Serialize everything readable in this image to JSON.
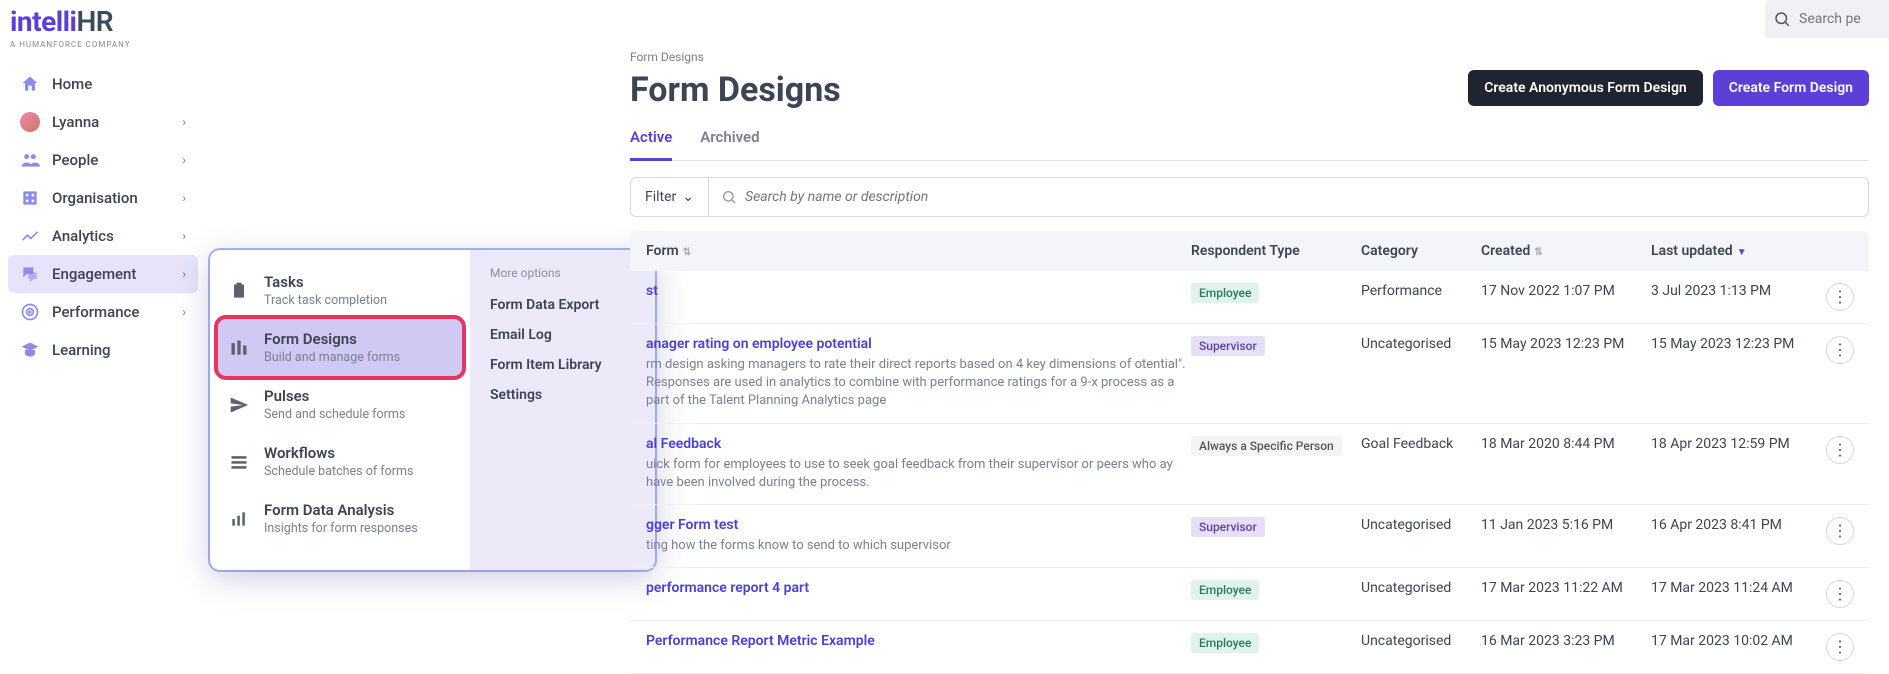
{
  "logo": {
    "brand": "intelli",
    "suffix": "HR",
    "tagline": "A HUMANFORCE COMPANY"
  },
  "search_placeholder": "Search pe",
  "sidebar": [
    {
      "label": "Home",
      "icon": "home",
      "expandable": false
    },
    {
      "label": "Lyanna",
      "icon": "avatar",
      "expandable": true
    },
    {
      "label": "People",
      "icon": "people",
      "expandable": true
    },
    {
      "label": "Organisation",
      "icon": "org",
      "expandable": true
    },
    {
      "label": "Analytics",
      "icon": "analytics",
      "expandable": true
    },
    {
      "label": "Engagement",
      "icon": "engagement",
      "expandable": true,
      "active": true
    },
    {
      "label": "Performance",
      "icon": "performance",
      "expandable": true
    },
    {
      "label": "Learning",
      "icon": "learning",
      "expandable": false
    }
  ],
  "flyout": {
    "items": [
      {
        "title": "Tasks",
        "desc": "Track task completion",
        "icon": "clipboard"
      },
      {
        "title": "Form Designs",
        "desc": "Build and manage forms",
        "icon": "forms",
        "selected": true
      },
      {
        "title": "Pulses",
        "desc": "Send and schedule forms",
        "icon": "send"
      },
      {
        "title": "Workflows",
        "desc": "Schedule batches of forms",
        "icon": "workflow"
      },
      {
        "title": "Form Data Analysis",
        "desc": "Insights for form responses",
        "icon": "chart"
      }
    ],
    "more_label": "More options",
    "links": [
      "Form Data Export",
      "Email Log",
      "Form Item Library",
      "Settings"
    ]
  },
  "breadcrumb": "Form Designs",
  "page_title": "Form Designs",
  "buttons": {
    "anon": "Create Anonymous Form Design",
    "create": "Create Form Design"
  },
  "tabs": {
    "active": "Active",
    "archived": "Archived"
  },
  "filter": {
    "label": "Filter",
    "search_placeholder": "Search by name or description"
  },
  "columns": {
    "form": "Form",
    "respondent": "Respondent Type",
    "category": "Category",
    "created": "Created",
    "updated": "Last updated"
  },
  "rows": [
    {
      "name": "st",
      "desc": "",
      "respondent": "Employee",
      "resp_class": "employee",
      "category": "Performance",
      "created": "17 Nov 2022 1:07 PM",
      "updated": "3 Jul 2023 1:13 PM"
    },
    {
      "name": "anager rating on employee potential",
      "desc": "rm design asking managers to rate their direct reports based on 4 key dimensions of otential\". Responses are used in analytics to combine with performance ratings for a 9-x process as a part of the Talent Planning Analytics page",
      "respondent": "Supervisor",
      "resp_class": "supervisor",
      "category": "Uncategorised",
      "created": "15 May 2023 12:23 PM",
      "updated": "15 May 2023 12:23 PM"
    },
    {
      "name": "al Feedback",
      "desc": "uick form for employees to use to seek goal feedback from their supervisor or peers who ay have been involved during the process.",
      "respondent": "Always a Specific Person",
      "resp_class": "specific",
      "category": "Goal Feedback",
      "created": "18 Mar 2020 8:44 PM",
      "updated": "18 Apr 2023 12:59 PM"
    },
    {
      "name": "gger Form test",
      "desc": "ting how the forms know to send to which supervisor",
      "respondent": "Supervisor",
      "resp_class": "supervisor",
      "category": "Uncategorised",
      "created": "11 Jan 2023 5:16 PM",
      "updated": "16 Apr 2023 8:41 PM"
    },
    {
      "name": "performance report 4 part",
      "desc": "",
      "respondent": "Employee",
      "resp_class": "employee",
      "category": "Uncategorised",
      "created": "17 Mar 2023 11:22 AM",
      "updated": "17 Mar 2023 11:24 AM"
    },
    {
      "name": "Performance Report Metric Example",
      "desc": "",
      "respondent": "Employee",
      "resp_class": "employee",
      "category": "Uncategorised",
      "created": "16 Mar 2023 3:23 PM",
      "updated": "17 Mar 2023 10:02 AM"
    }
  ]
}
